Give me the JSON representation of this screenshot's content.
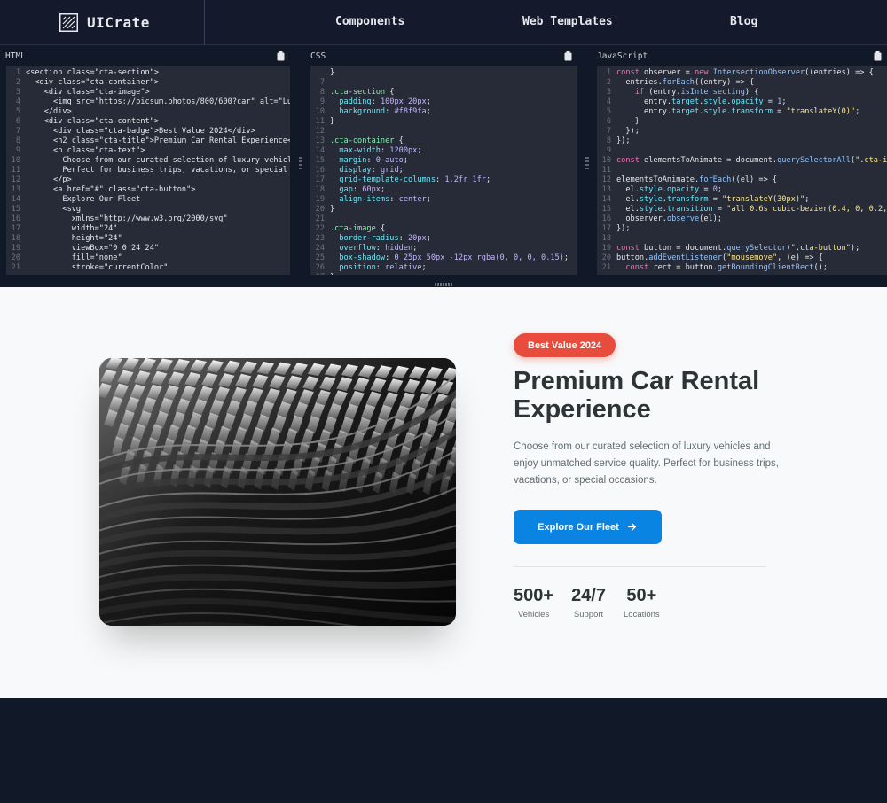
{
  "brand": {
    "name": "UICrate"
  },
  "nav": {
    "components": "Components",
    "templates": "Web Templates",
    "blog": "Blog"
  },
  "editors": {
    "html_title": "HTML",
    "css_title": "CSS",
    "js_title": "JavaScript"
  },
  "preview": {
    "badge": "Best Value 2024",
    "title": "Premium Car Rental Experience",
    "text": "Choose from our curated selection of luxury vehicles and enjoy unmatched service quality. Perfect for business trips, vacations, or special occasions.",
    "button": "Explore Our Fleet",
    "stats": [
      {
        "value": "500+",
        "label": "Vehicles"
      },
      {
        "value": "24/7",
        "label": "Support"
      },
      {
        "value": "50+",
        "label": "Locations"
      }
    ]
  },
  "colors": {
    "badge": "#e74c3c",
    "button": "#0984e3",
    "title": "#2d3436",
    "text": "#636e72"
  },
  "icons": [
    "logo-icon",
    "clipboard-icon",
    "arrow-right-icon"
  ]
}
